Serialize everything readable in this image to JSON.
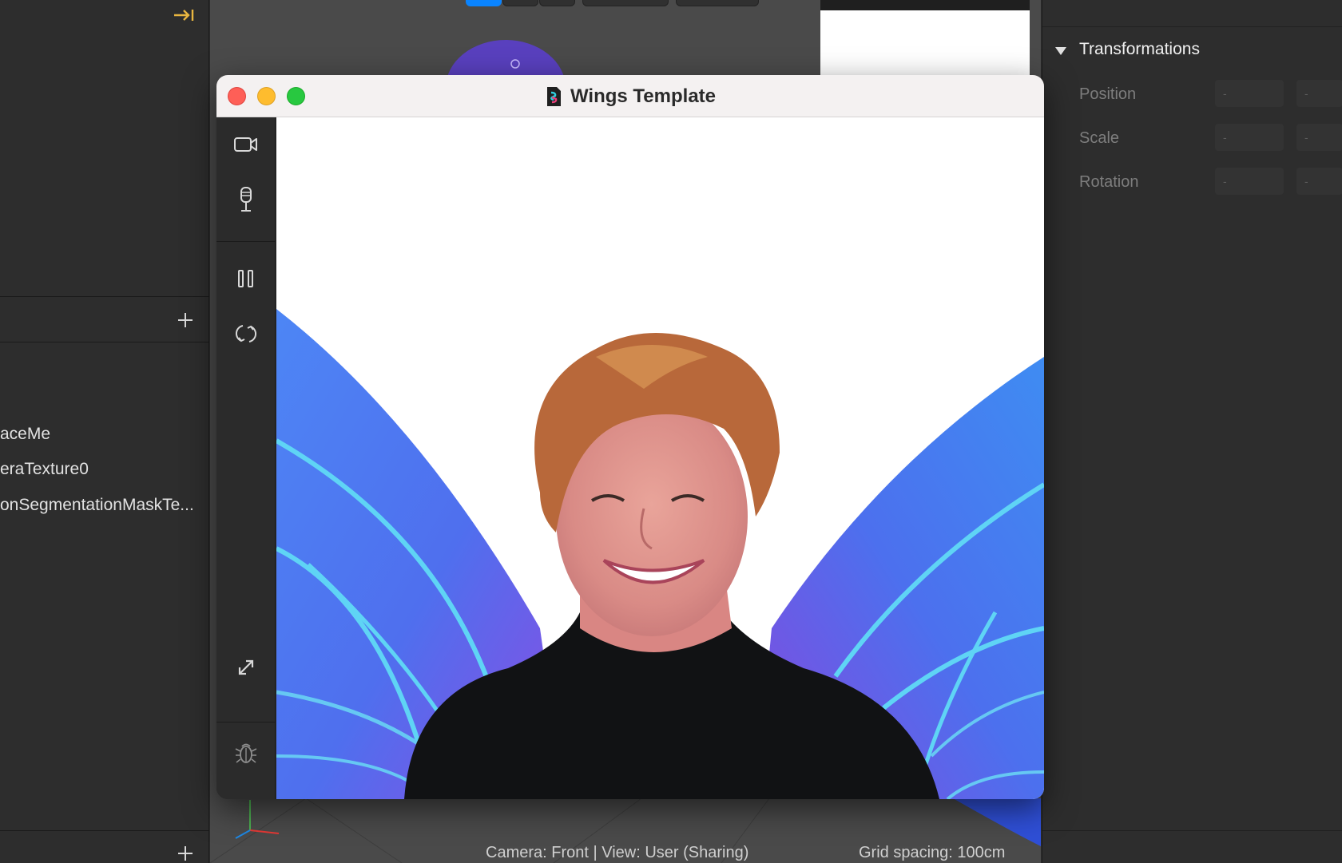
{
  "left_panel": {
    "assets": [
      "aceMe",
      "eraTexture0",
      "onSegmentationMaskTe..."
    ]
  },
  "viewport": {
    "status_camera": "Camera: Front | View: User (Sharing)",
    "status_grid": "Grid spacing: 100cm"
  },
  "right_panel": {
    "section_title": "Transformations",
    "props": {
      "position": "Position",
      "scale": "Scale",
      "rotation": "Rotation"
    },
    "field_placeholder": "-"
  },
  "simulator": {
    "title": "Wings Template"
  },
  "colors": {
    "accent": "#0a84ff",
    "collapse_icon": "#e9b640",
    "wing_blue": "#3f7bf2",
    "wing_purple": "#8a4be0",
    "wing_vein": "#5fd4f5"
  }
}
